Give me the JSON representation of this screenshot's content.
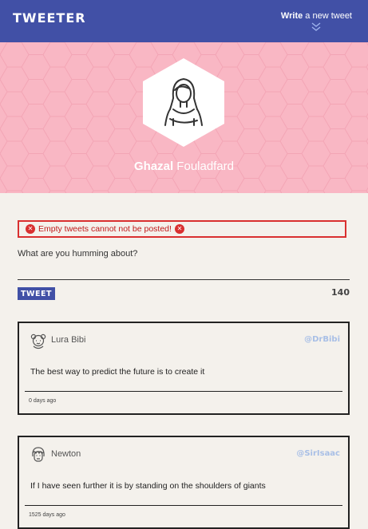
{
  "nav": {
    "logo": "TWEETER",
    "compose_bold": "Write",
    "compose_rest": " a new tweet"
  },
  "profile": {
    "first_name": "Ghazal",
    "last_name": " Fouladfard"
  },
  "compose": {
    "error_text": "Empty tweets cannot not be posted!",
    "prompt": "What are you humming about?",
    "button_label": "TWEET",
    "char_count": "140"
  },
  "tweets": [
    {
      "name": "Lura Bibi",
      "handle": "@DrBibi",
      "text": "The best way to predict the future is to create it",
      "time": "0 days ago"
    },
    {
      "name": "Newton",
      "handle": "@SirIsaac",
      "text": "If I have seen further it is by standing on the shoulders of giants",
      "time": "1525 days ago"
    }
  ],
  "colors": {
    "nav": "#4150a6",
    "header": "#f9b7c4",
    "error": "#d93030",
    "handle": "#a8bfe6"
  }
}
